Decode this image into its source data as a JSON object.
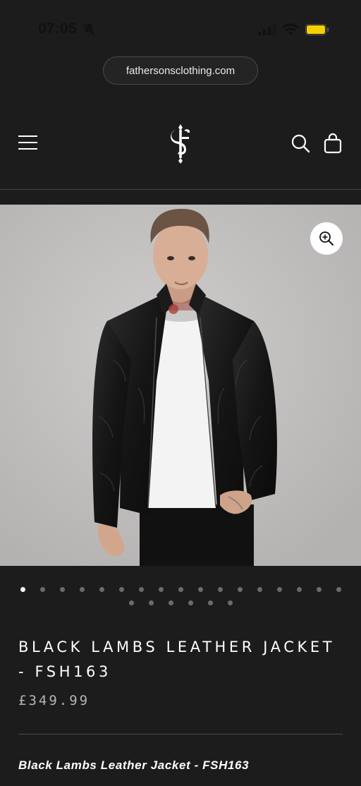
{
  "status_bar": {
    "time": "07:05",
    "icons": [
      "bell-slash-icon",
      "cellular-signal-icon",
      "wifi-icon",
      "battery-icon"
    ],
    "battery_color": "#f5d000"
  },
  "browser": {
    "url": "fathersonsclothing.com"
  },
  "header": {
    "menu_icon": "hamburger-menu-icon",
    "logo_icon": "fatherson-monogram-logo",
    "search_icon": "search-icon",
    "cart_icon": "shopping-bag-icon"
  },
  "gallery": {
    "zoom_icon": "zoom-in-icon",
    "image_alt": "Black Lambs Leather Jacket - FSH163",
    "slide_count": 23,
    "active_index": 0
  },
  "product": {
    "title": "BLACK LAMBS LEATHER JACKET - FSH163",
    "price": "£349.99",
    "subtitle": "Black Lambs Leather Jacket - FSH163"
  },
  "colors": {
    "background": "#1c1c1c",
    "text": "#ffffff",
    "price": "#b5b5b5",
    "dot_inactive": "#6b6b6b",
    "dot_active": "#ffffff"
  }
}
